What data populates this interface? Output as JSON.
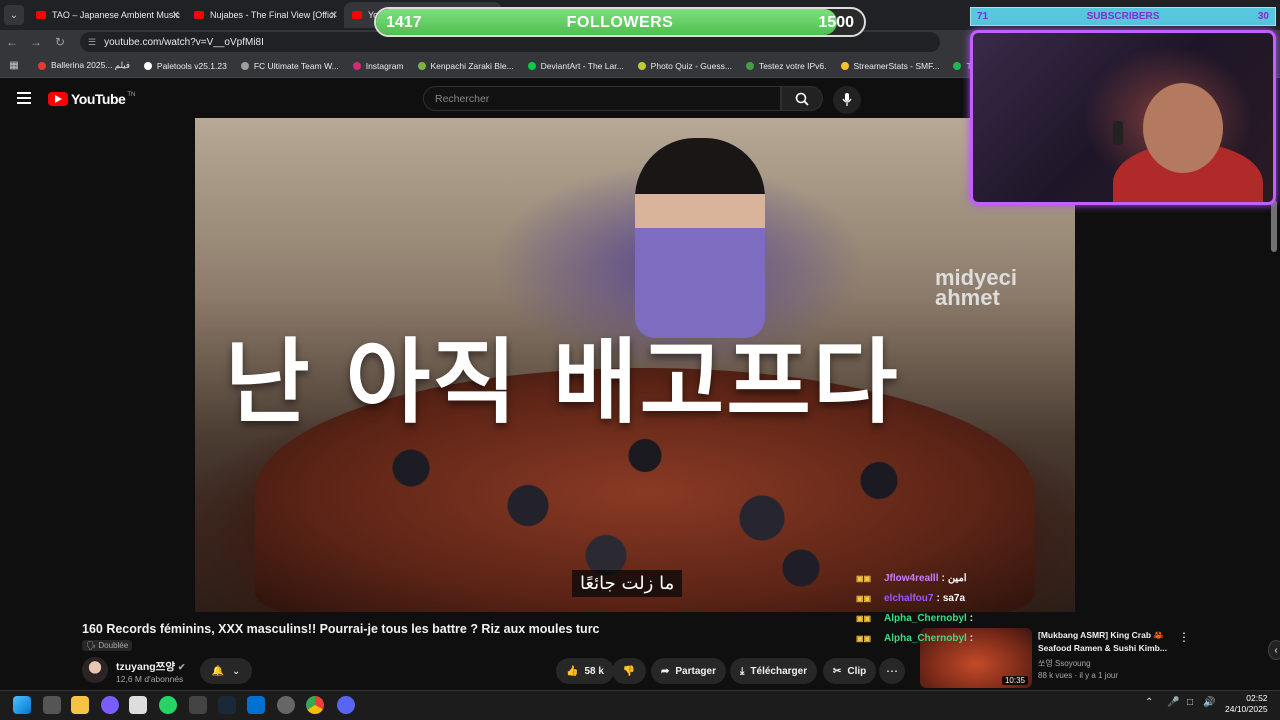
{
  "browser": {
    "tabs": [
      {
        "title": "TAO – Japanese Ambient Music"
      },
      {
        "title": "Nujabes - The Final View [Offici"
      },
      {
        "title": "You"
      }
    ],
    "url": "youtube.com/watch?v=V__oVpfMi8I",
    "bookmarks": [
      {
        "label": "Ballerina 2025... فيلم",
        "color": "#e53935"
      },
      {
        "label": "Paletools v25.1.23",
        "color": "#ffffff"
      },
      {
        "label": "FC Ultimate Team W...",
        "color": "#9e9e9e"
      },
      {
        "label": "Instagram",
        "color": "#d62976"
      },
      {
        "label": "Kenpachi Zaraki Ble...",
        "color": "#7cb342"
      },
      {
        "label": "DeviantArt - The Lar...",
        "color": "#05cc47"
      },
      {
        "label": "Photo Quiz - Guess...",
        "color": "#c0ca33"
      },
      {
        "label": "Testez votre IPv6.",
        "color": "#43a047"
      },
      {
        "label": "StreamerStats - SMF...",
        "color": "#fbc02d"
      },
      {
        "label": "Tell It To My Heart",
        "color": "#1db954"
      }
    ]
  },
  "youtube": {
    "wordmark": "YouTube",
    "country": "TN",
    "search_placeholder": "Rechercher"
  },
  "video": {
    "caption_korean": "난 아직 배고프다",
    "subtitle": "ما زلت جائعًا",
    "brand_watermark": "midyeci ahmet",
    "title": "160 Records féminins, XXX masculins!! Pourrai-je tous les battre ? Riz aux moules turc",
    "dubbed_label": "Doublée",
    "channel": "tzuyang쯔양",
    "subscribers": "12,6 M d'abonnés",
    "likes": "58 k",
    "share_label": "Partager",
    "download_label": "Télécharger",
    "clip_label": "Clip"
  },
  "recommended": {
    "title": "[Mukbang ASMR] King Crab 🦀 Seafood Ramen & Sushi Kimb...",
    "channel": "쏘영 Ssoyoung",
    "meta": "88 k vues · il y a 1 jour",
    "duration": "10:35"
  },
  "overlay": {
    "followers": {
      "current": "1417",
      "label": "FOLLOWERS",
      "goal": "1500",
      "progress": 0.945
    },
    "subscribers": {
      "current": "71",
      "label": "SUBSCRIBERS",
      "goal": "30"
    },
    "chat": [
      {
        "user": "Jflow4realll",
        "message": "امين",
        "color": "#c77dff"
      },
      {
        "user": "elchalfou7",
        "message": "sa7a",
        "color": "#9b59ff"
      },
      {
        "user": "Alpha_Chernobyl",
        "message": "",
        "color": "#3ddc84"
      },
      {
        "user": "Alpha_Chernobyl",
        "message": "",
        "color": "#3ddc84"
      }
    ]
  },
  "taskbar": {
    "time": "02:52",
    "date": "24/10/2025"
  }
}
